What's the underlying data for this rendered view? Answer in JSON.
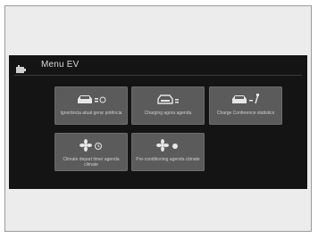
{
  "screen": {
    "title": "Menu EV",
    "title_icon": "battery-icon"
  },
  "tiles": [
    {
      "label": "Ignorância atual gerar potência",
      "icon": "car-timer-icon"
    },
    {
      "label": "Charging agora agenda",
      "icon": "car-charge-icon"
    },
    {
      "label": "Charge Conference statistics",
      "icon": "car-plug-icon"
    },
    {
      "label": "Climate depart timer agenda climate",
      "icon": "fan-timer-icon"
    },
    {
      "label": "Pre-conditioning agenda climate",
      "icon": "fan-climate-icon"
    }
  ],
  "colors": {
    "screen_bg": "#141414",
    "tile_bg": "#5b5b5b",
    "text": "#cfcfcf"
  }
}
